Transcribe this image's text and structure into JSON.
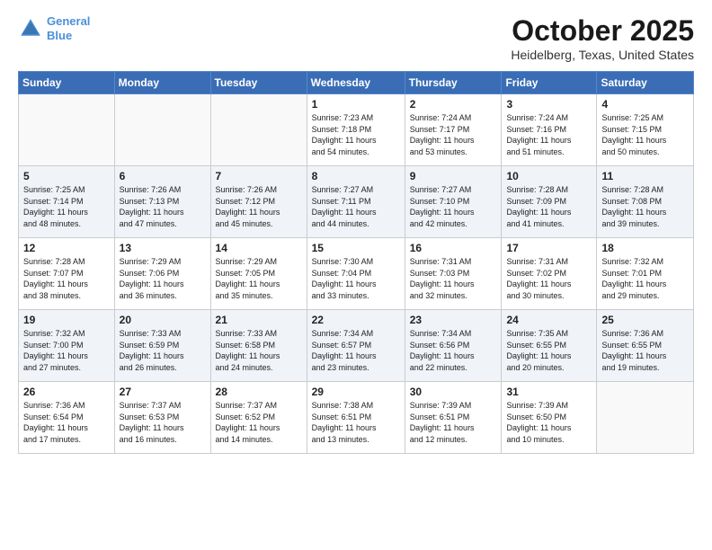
{
  "header": {
    "logo_line1": "General",
    "logo_line2": "Blue",
    "month": "October 2025",
    "location": "Heidelberg, Texas, United States"
  },
  "weekdays": [
    "Sunday",
    "Monday",
    "Tuesday",
    "Wednesday",
    "Thursday",
    "Friday",
    "Saturday"
  ],
  "weeks": [
    [
      {
        "day": "",
        "info": ""
      },
      {
        "day": "",
        "info": ""
      },
      {
        "day": "",
        "info": ""
      },
      {
        "day": "1",
        "info": "Sunrise: 7:23 AM\nSunset: 7:18 PM\nDaylight: 11 hours\nand 54 minutes."
      },
      {
        "day": "2",
        "info": "Sunrise: 7:24 AM\nSunset: 7:17 PM\nDaylight: 11 hours\nand 53 minutes."
      },
      {
        "day": "3",
        "info": "Sunrise: 7:24 AM\nSunset: 7:16 PM\nDaylight: 11 hours\nand 51 minutes."
      },
      {
        "day": "4",
        "info": "Sunrise: 7:25 AM\nSunset: 7:15 PM\nDaylight: 11 hours\nand 50 minutes."
      }
    ],
    [
      {
        "day": "5",
        "info": "Sunrise: 7:25 AM\nSunset: 7:14 PM\nDaylight: 11 hours\nand 48 minutes."
      },
      {
        "day": "6",
        "info": "Sunrise: 7:26 AM\nSunset: 7:13 PM\nDaylight: 11 hours\nand 47 minutes."
      },
      {
        "day": "7",
        "info": "Sunrise: 7:26 AM\nSunset: 7:12 PM\nDaylight: 11 hours\nand 45 minutes."
      },
      {
        "day": "8",
        "info": "Sunrise: 7:27 AM\nSunset: 7:11 PM\nDaylight: 11 hours\nand 44 minutes."
      },
      {
        "day": "9",
        "info": "Sunrise: 7:27 AM\nSunset: 7:10 PM\nDaylight: 11 hours\nand 42 minutes."
      },
      {
        "day": "10",
        "info": "Sunrise: 7:28 AM\nSunset: 7:09 PM\nDaylight: 11 hours\nand 41 minutes."
      },
      {
        "day": "11",
        "info": "Sunrise: 7:28 AM\nSunset: 7:08 PM\nDaylight: 11 hours\nand 39 minutes."
      }
    ],
    [
      {
        "day": "12",
        "info": "Sunrise: 7:28 AM\nSunset: 7:07 PM\nDaylight: 11 hours\nand 38 minutes."
      },
      {
        "day": "13",
        "info": "Sunrise: 7:29 AM\nSunset: 7:06 PM\nDaylight: 11 hours\nand 36 minutes."
      },
      {
        "day": "14",
        "info": "Sunrise: 7:29 AM\nSunset: 7:05 PM\nDaylight: 11 hours\nand 35 minutes."
      },
      {
        "day": "15",
        "info": "Sunrise: 7:30 AM\nSunset: 7:04 PM\nDaylight: 11 hours\nand 33 minutes."
      },
      {
        "day": "16",
        "info": "Sunrise: 7:31 AM\nSunset: 7:03 PM\nDaylight: 11 hours\nand 32 minutes."
      },
      {
        "day": "17",
        "info": "Sunrise: 7:31 AM\nSunset: 7:02 PM\nDaylight: 11 hours\nand 30 minutes."
      },
      {
        "day": "18",
        "info": "Sunrise: 7:32 AM\nSunset: 7:01 PM\nDaylight: 11 hours\nand 29 minutes."
      }
    ],
    [
      {
        "day": "19",
        "info": "Sunrise: 7:32 AM\nSunset: 7:00 PM\nDaylight: 11 hours\nand 27 minutes."
      },
      {
        "day": "20",
        "info": "Sunrise: 7:33 AM\nSunset: 6:59 PM\nDaylight: 11 hours\nand 26 minutes."
      },
      {
        "day": "21",
        "info": "Sunrise: 7:33 AM\nSunset: 6:58 PM\nDaylight: 11 hours\nand 24 minutes."
      },
      {
        "day": "22",
        "info": "Sunrise: 7:34 AM\nSunset: 6:57 PM\nDaylight: 11 hours\nand 23 minutes."
      },
      {
        "day": "23",
        "info": "Sunrise: 7:34 AM\nSunset: 6:56 PM\nDaylight: 11 hours\nand 22 minutes."
      },
      {
        "day": "24",
        "info": "Sunrise: 7:35 AM\nSunset: 6:55 PM\nDaylight: 11 hours\nand 20 minutes."
      },
      {
        "day": "25",
        "info": "Sunrise: 7:36 AM\nSunset: 6:55 PM\nDaylight: 11 hours\nand 19 minutes."
      }
    ],
    [
      {
        "day": "26",
        "info": "Sunrise: 7:36 AM\nSunset: 6:54 PM\nDaylight: 11 hours\nand 17 minutes."
      },
      {
        "day": "27",
        "info": "Sunrise: 7:37 AM\nSunset: 6:53 PM\nDaylight: 11 hours\nand 16 minutes."
      },
      {
        "day": "28",
        "info": "Sunrise: 7:37 AM\nSunset: 6:52 PM\nDaylight: 11 hours\nand 14 minutes."
      },
      {
        "day": "29",
        "info": "Sunrise: 7:38 AM\nSunset: 6:51 PM\nDaylight: 11 hours\nand 13 minutes."
      },
      {
        "day": "30",
        "info": "Sunrise: 7:39 AM\nSunset: 6:51 PM\nDaylight: 11 hours\nand 12 minutes."
      },
      {
        "day": "31",
        "info": "Sunrise: 7:39 AM\nSunset: 6:50 PM\nDaylight: 11 hours\nand 10 minutes."
      },
      {
        "day": "",
        "info": ""
      }
    ]
  ]
}
